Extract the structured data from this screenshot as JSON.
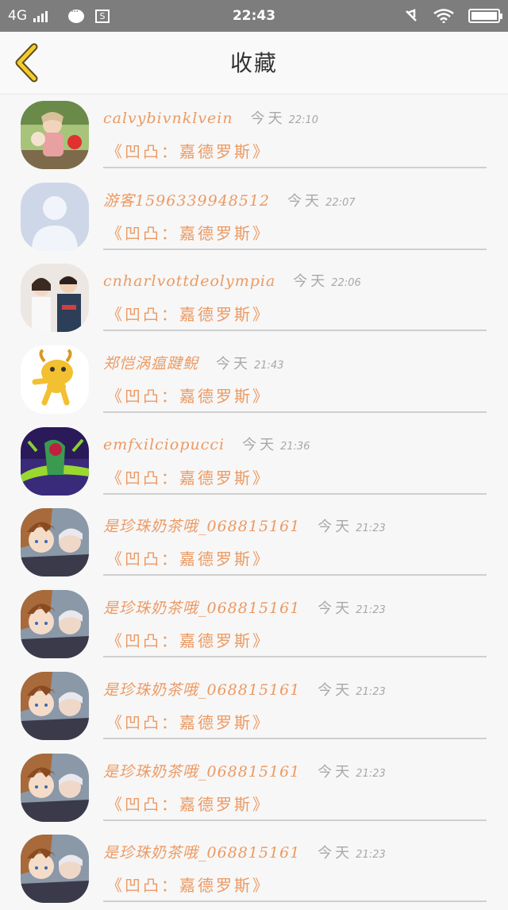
{
  "status_bar": {
    "network": "4G",
    "time": "22:43"
  },
  "nav": {
    "title": "收藏"
  },
  "messages": [
    {
      "name": "calvybivnklvein",
      "day": "今天",
      "time": "22:10",
      "subject": "《凹凸：嘉德罗斯》",
      "avatar_icon": "girls-photo-avatar"
    },
    {
      "name": "游客1596339948512",
      "day": "今天",
      "time": "22:07",
      "subject": "《凹凸：嘉德罗斯》",
      "avatar_icon": "default-user-avatar"
    },
    {
      "name": "cnharlvottdeolympia",
      "day": "今天",
      "time": "22:06",
      "subject": "《凹凸：嘉德罗斯》",
      "avatar_icon": "couple-photo-avatar"
    },
    {
      "name": "郑恺涡瘟踺鲵",
      "day": "今天",
      "time": "21:43",
      "subject": "《凹凸：嘉德罗斯》",
      "avatar_icon": "cartoon-goat-avatar"
    },
    {
      "name": "emfxilciopucci",
      "day": "今天",
      "time": "21:36",
      "subject": "《凹凸：嘉德罗斯》",
      "avatar_icon": "purple-creature-avatar"
    },
    {
      "name": "是珍珠奶茶哦_068815161",
      "day": "今天",
      "time": "21:23",
      "subject": "《凹凸：嘉德罗斯》",
      "avatar_icon": "anime-characters-avatar"
    },
    {
      "name": "是珍珠奶茶哦_068815161",
      "day": "今天",
      "time": "21:23",
      "subject": "《凹凸：嘉德罗斯》",
      "avatar_icon": "anime-characters-avatar"
    },
    {
      "name": "是珍珠奶茶哦_068815161",
      "day": "今天",
      "time": "21:23",
      "subject": "《凹凸：嘉德罗斯》",
      "avatar_icon": "anime-characters-avatar"
    },
    {
      "name": "是珍珠奶茶哦_068815161",
      "day": "今天",
      "time": "21:23",
      "subject": "《凹凸：嘉德罗斯》",
      "avatar_icon": "anime-characters-avatar"
    },
    {
      "name": "是珍珠奶茶哦_068815161",
      "day": "今天",
      "time": "21:23",
      "subject": "《凹凸：嘉德罗斯》",
      "avatar_icon": "anime-characters-avatar"
    }
  ],
  "colors": {
    "accent": "#ec9a63",
    "back_icon": "#f2cc2e",
    "muted": "#a8a8a8",
    "status_bar": "#7d7d7d"
  }
}
